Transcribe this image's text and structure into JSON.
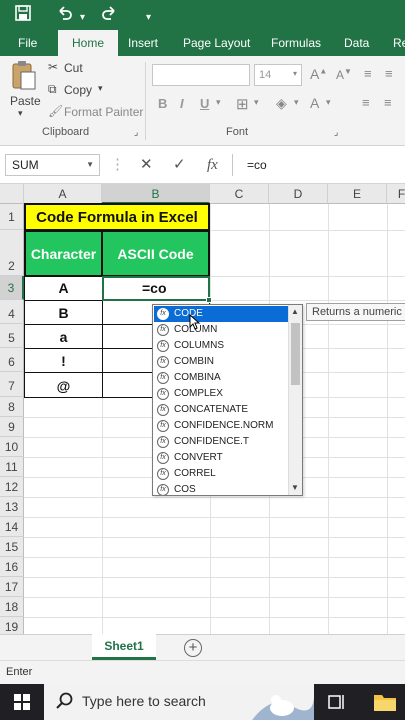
{
  "titlebar": {
    "save_icon": "save-icon",
    "undo_icon": "undo-icon",
    "colors": {
      "excel_green": "#217346"
    }
  },
  "ribbon": {
    "tabs": [
      "File",
      "Home",
      "Insert",
      "Page Layout",
      "Formulas",
      "Data",
      "Re"
    ],
    "active_tab": "Home",
    "clipboard": {
      "paste": "Paste",
      "cut": "Cut",
      "copy": "Copy",
      "format_painter": "Format Painter",
      "group_label": "Clipboard"
    },
    "font": {
      "font_name": "",
      "font_size": "14",
      "bold": "B",
      "italic": "I",
      "underline": "U",
      "group_label": "Font"
    }
  },
  "formula_bar": {
    "name_box": "SUM",
    "formula": "=co"
  },
  "grid": {
    "columns": [
      "A",
      "B",
      "C",
      "D",
      "E",
      "F"
    ],
    "rows": [
      "1",
      "2",
      "3",
      "4",
      "5",
      "6",
      "7",
      "8",
      "9",
      "10",
      "11",
      "12",
      "13",
      "14",
      "15",
      "16",
      "17",
      "18",
      "19"
    ],
    "title": "Code Formula in Excel",
    "header_character": "Character",
    "header_ascii": "ASCII Code",
    "characters": [
      "A",
      "B",
      "a",
      "!",
      "@"
    ],
    "active_value": "=co",
    "colors": {
      "title_bg": "#ffff00",
      "header_bg": "#22c55e"
    }
  },
  "autocomplete": {
    "items": [
      "CODE",
      "COLUMN",
      "COLUMNS",
      "COMBIN",
      "COMBINA",
      "COMPLEX",
      "CONCATENATE",
      "CONFIDENCE.NORM",
      "CONFIDENCE.T",
      "CONVERT",
      "CORREL",
      "COS"
    ],
    "selected": "CODE",
    "tooltip": "Returns a numeric"
  },
  "sheets": {
    "tabs": [
      "Sheet1"
    ],
    "add_icon": "plus-circle-icon"
  },
  "status": {
    "mode": "Enter"
  },
  "taskbar": {
    "search_placeholder": "Type here to search"
  }
}
